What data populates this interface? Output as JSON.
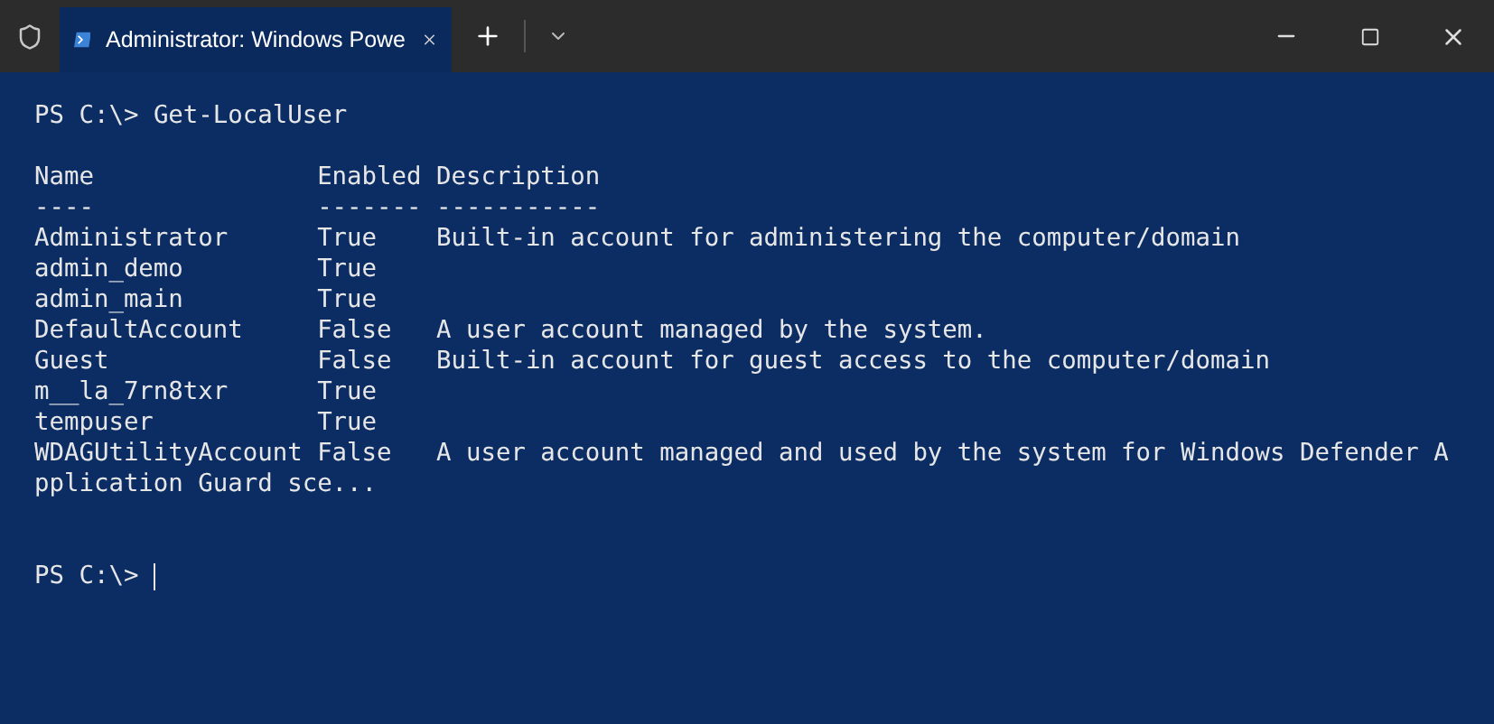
{
  "tab_bar": {
    "tab": {
      "title": "Administrator: Windows Powe",
      "selected": true
    }
  },
  "terminal": {
    "command": {
      "prompt": "PS C:\\>",
      "text": "Get-LocalUser"
    },
    "output_lines": [
      "Name               Enabled Description",
      "----               ------- -----------",
      "Administrator      True    Built-in account for administering the computer/domain",
      "admin_demo         True",
      "admin_main         True",
      "DefaultAccount     False   A user account managed by the system.",
      "Guest              False   Built-in account for guest access to the computer/domain",
      "m__la_7rn8txr      True",
      "tempuser           True",
      "WDAGUtilityAccount False   A user account managed and used by the system for Windows Defender A",
      "pplication Guard sce..."
    ],
    "prompt": "PS C:\\>"
  }
}
